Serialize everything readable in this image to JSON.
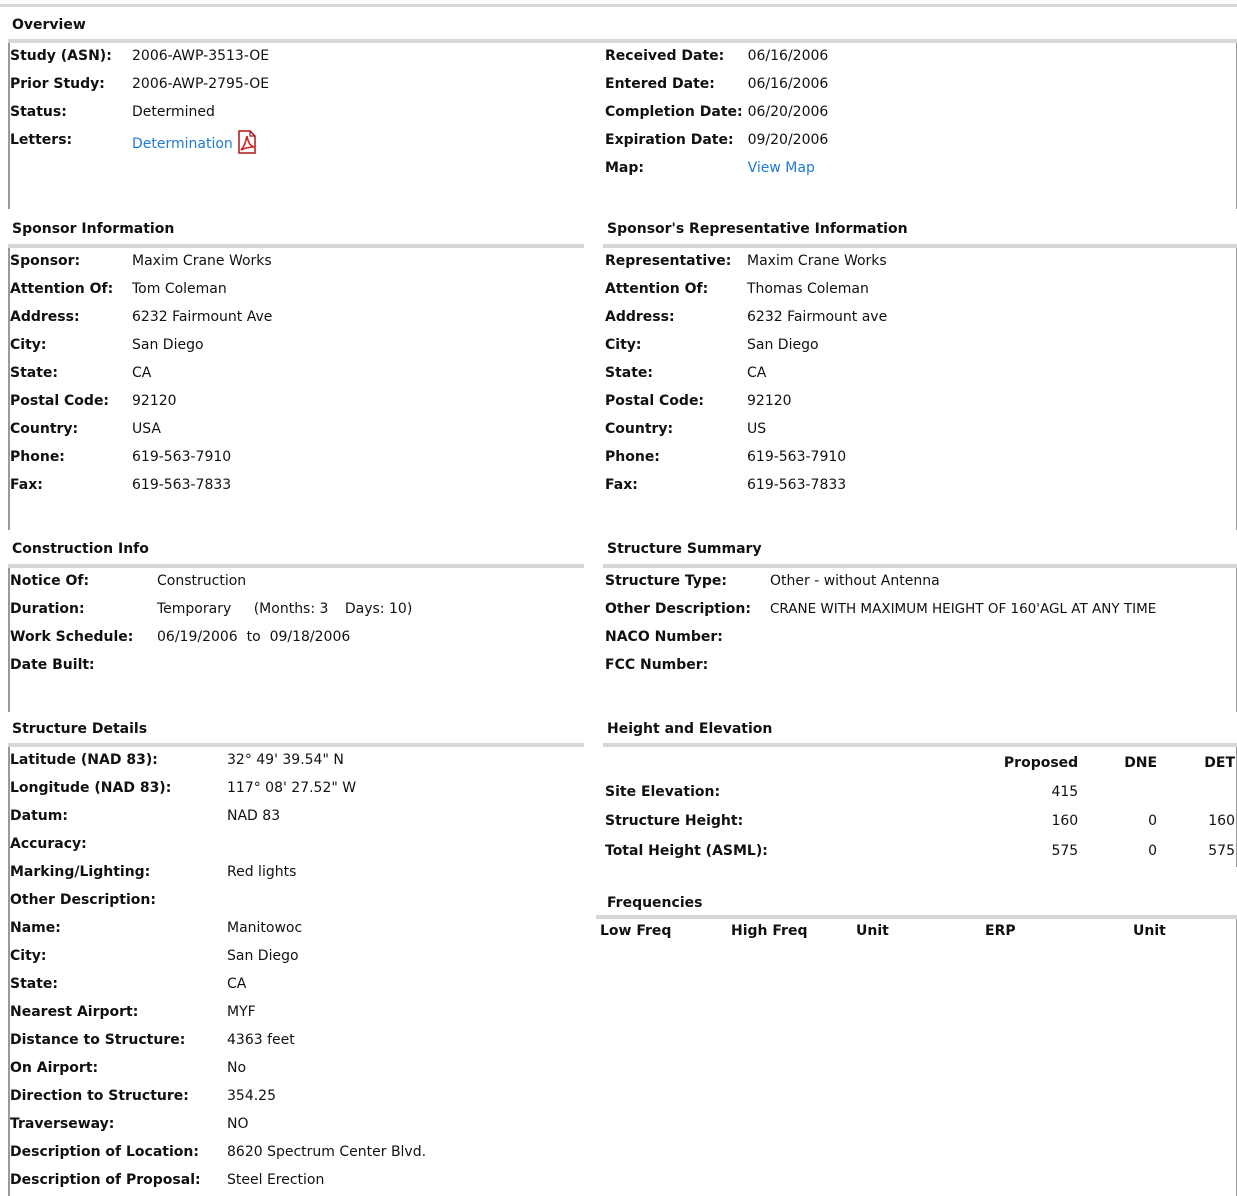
{
  "overview": {
    "title": "Overview",
    "left": [
      {
        "label": "Study (ASN):",
        "value": "2006-AWP-3513-OE"
      },
      {
        "label": "Prior Study:",
        "value": "2006-AWP-2795-OE"
      },
      {
        "label": "Status:",
        "value": "Determined"
      }
    ],
    "letters_label": "Letters:",
    "letters_link": "Determination",
    "right": [
      {
        "label": "Received Date:",
        "value": "06/16/2006"
      },
      {
        "label": "Entered Date:",
        "value": "06/16/2006"
      },
      {
        "label": "Completion Date:",
        "value": "06/20/2006"
      },
      {
        "label": "Expiration Date:",
        "value": "09/20/2006"
      }
    ],
    "map_label": "Map:",
    "map_link": "View Map"
  },
  "sponsor": {
    "title": "Sponsor Information",
    "rows": [
      {
        "label": "Sponsor:",
        "value": "Maxim Crane Works"
      },
      {
        "label": "Attention Of:",
        "value": "Tom Coleman"
      },
      {
        "label": "Address:",
        "value": "6232 Fairmount Ave"
      },
      {
        "label": "City:",
        "value": "San Diego"
      },
      {
        "label": "State:",
        "value": "CA"
      },
      {
        "label": "Postal Code:",
        "value": "92120"
      },
      {
        "label": "Country:",
        "value": "USA"
      },
      {
        "label": "Phone:",
        "value": "619-563-7910"
      },
      {
        "label": "Fax:",
        "value": "619-563-7833"
      }
    ]
  },
  "representative": {
    "title": "Sponsor's Representative Information",
    "rows": [
      {
        "label": "Representative:",
        "value": "Maxim Crane Works"
      },
      {
        "label": "Attention Of:",
        "value": "Thomas Coleman"
      },
      {
        "label": "Address:",
        "value": "6232 Fairmount ave"
      },
      {
        "label": "City:",
        "value": "San Diego"
      },
      {
        "label": "State:",
        "value": "CA"
      },
      {
        "label": "Postal Code:",
        "value": "92120"
      },
      {
        "label": "Country:",
        "value": "US"
      },
      {
        "label": "Phone:",
        "value": "619-563-7910"
      },
      {
        "label": "Fax:",
        "value": "619-563-7833"
      }
    ]
  },
  "construction": {
    "title": "Construction Info",
    "notice_label": "Notice Of:",
    "notice_value": "Construction",
    "duration_label": "Duration:",
    "duration_value": "Temporary",
    "duration_months_label": "(Months:",
    "duration_months": "3",
    "duration_days_label": "Days:",
    "duration_days": "10)",
    "schedule_label": "Work Schedule:",
    "schedule_from": "06/19/2006",
    "schedule_to_word": "to",
    "schedule_to": "09/18/2006",
    "built_label": "Date Built:",
    "built_value": ""
  },
  "structure_summary": {
    "title": "Structure Summary",
    "rows": [
      {
        "label": "Structure Type:",
        "value": "Other - without Antenna"
      },
      {
        "label": "Other Description:",
        "value": "CRANE WITH MAXIMUM HEIGHT OF 160'AGL AT ANY TIME"
      },
      {
        "label": "NACO Number:",
        "value": ""
      },
      {
        "label": "FCC Number:",
        "value": ""
      }
    ]
  },
  "structure_details": {
    "title": "Structure Details",
    "rows": [
      {
        "label": "Latitude (NAD 83):",
        "value": "32° 49' 39.54\" N"
      },
      {
        "label": "Longitude (NAD 83):",
        "value": "117° 08' 27.52\" W"
      },
      {
        "label": "Datum:",
        "value": "NAD 83"
      },
      {
        "label": "Accuracy:",
        "value": ""
      },
      {
        "label": "Marking/Lighting:",
        "value": "Red lights"
      },
      {
        "label": "Other Description:",
        "value": ""
      },
      {
        "label": "Name:",
        "value": "Manitowoc"
      },
      {
        "label": "City:",
        "value": "San Diego"
      },
      {
        "label": "State:",
        "value": "CA"
      },
      {
        "label": "Nearest Airport:",
        "value": "MYF"
      },
      {
        "label": "Distance to Structure:",
        "value": "4363 feet"
      },
      {
        "label": "On Airport:",
        "value": "No"
      },
      {
        "label": "Direction to Structure:",
        "value": "354.25"
      },
      {
        "label": "Traverseway:",
        "value": "NO"
      },
      {
        "label": "Description of Location:",
        "value": "8620 Spectrum Center Blvd."
      },
      {
        "label": "Description of Proposal:",
        "value": "Steel Erection"
      }
    ]
  },
  "height": {
    "title": "Height and Elevation",
    "columns": [
      "Proposed",
      "DNE",
      "DET"
    ],
    "rows": [
      {
        "label": "Site Elevation:",
        "proposed": "415",
        "dne": "",
        "det": ""
      },
      {
        "label": "Structure Height:",
        "proposed": "160",
        "dne": "0",
        "det": "160"
      },
      {
        "label": "Total Height (ASML):",
        "proposed": "575",
        "dne": "0",
        "det": "575"
      }
    ]
  },
  "frequencies": {
    "title": "Frequencies",
    "columns": [
      "Low Freq",
      "High Freq",
      "Unit",
      "ERP",
      "Unit"
    ]
  }
}
